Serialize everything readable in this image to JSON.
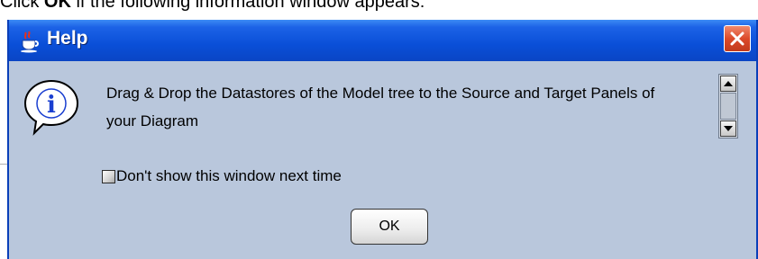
{
  "document": {
    "text_before": "Click ",
    "text_bold": "OK",
    "text_after": " if the following information window appears:"
  },
  "dialog": {
    "title": "Help",
    "title_icon": "java-cup-icon",
    "close_icon": "close-icon",
    "message": "Drag & Drop the Datastores of the Model tree to the Source and Target Panels of your Diagram",
    "info_icon": "info-icon",
    "checkbox_label": "Don't show this window next time",
    "checkbox_checked": false,
    "ok_label": "OK",
    "colors": {
      "titlebar": "#0a4fd8",
      "body": "#b9c7dc",
      "close_button": "#dc4a2a"
    }
  }
}
